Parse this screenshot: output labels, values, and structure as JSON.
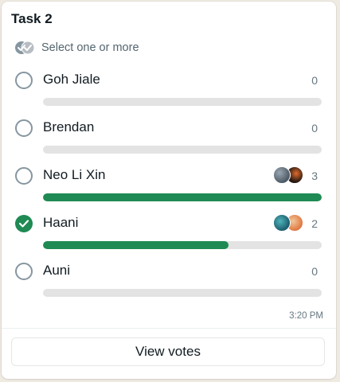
{
  "poll": {
    "title": "Task 2",
    "hint": "Select one or more",
    "timestamp": "3:20 PM",
    "view_votes_label": "View votes",
    "total_votes_for_scale": 3,
    "options": [
      {
        "label": "Goh Jiale",
        "count": "0",
        "votes": 0,
        "checked": false,
        "voter_avatars": []
      },
      {
        "label": "Brendan",
        "count": "0",
        "votes": 0,
        "checked": false,
        "voter_avatars": []
      },
      {
        "label": "Neo Li Xin",
        "count": "3",
        "votes": 3,
        "checked": false,
        "voter_avatars": [
          "avatar-voter-1",
          "avatar-voter-2"
        ]
      },
      {
        "label": "Haani",
        "count": "2",
        "votes": 2,
        "checked": true,
        "voter_avatars": [
          "avatar-voter-3",
          "avatar-voter-4"
        ]
      },
      {
        "label": "Auni",
        "count": "0",
        "votes": 0,
        "checked": false,
        "voter_avatars": []
      }
    ]
  },
  "colors": {
    "accent": "#1f8a53",
    "track": "#e3e3e3",
    "muted": "#667781"
  },
  "icons": {
    "multi_select": "double-check-circle-icon",
    "check": "check-icon"
  }
}
